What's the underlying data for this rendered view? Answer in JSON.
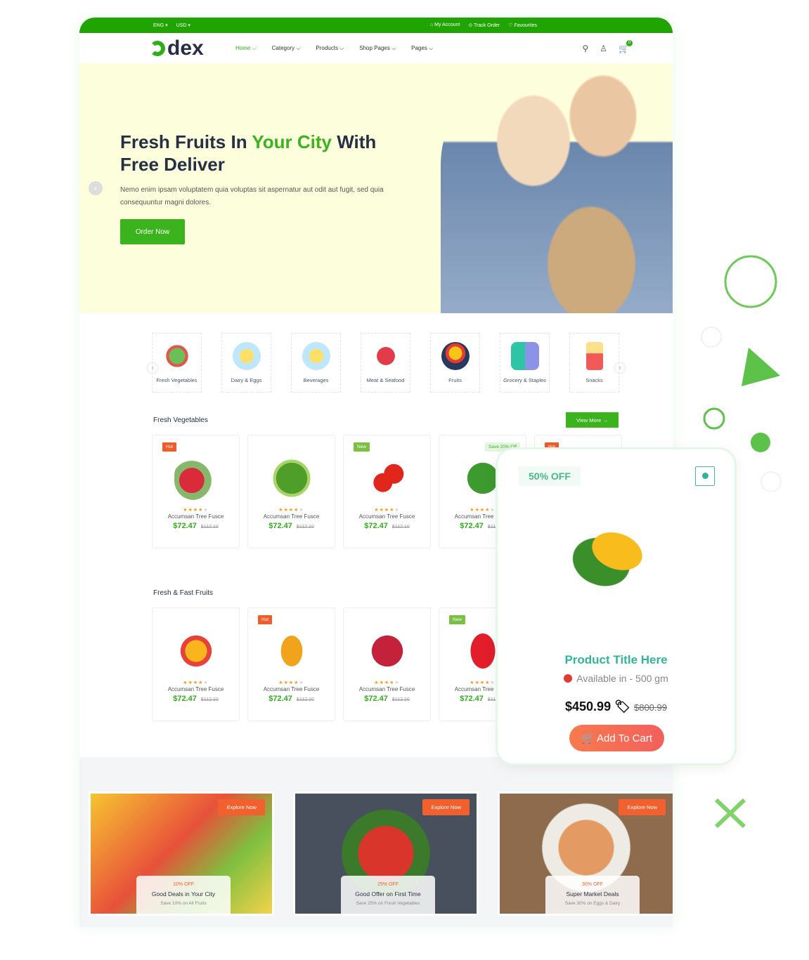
{
  "topbar": {
    "language": "ENG ▾",
    "currency": "USD ▾",
    "my_account": "My Account",
    "track_order": "Track Order",
    "favourites": "Favourites"
  },
  "header": {
    "logo": "dex",
    "nav": [
      "Home ⌵",
      "Category ⌵",
      "Products ⌵",
      "Shop Pages ⌵",
      "Pages ⌵"
    ],
    "cart_count": "0"
  },
  "hero": {
    "title_part1": "Fresh Fruits In ",
    "title_highlight": "Your City",
    "title_part2": " With Free Deliver",
    "text": "Nemo enim ipsam voluptatem quia voluptas sit aspernatur aut odit aut fugit, sed quia consequuntur magni dolores.",
    "button": "Order Now"
  },
  "categories": [
    "Fresh Vegetables",
    "Dairy & Eggs",
    "Beverages",
    "Meat & Seafood",
    "Fruits",
    "Grocery & Staples",
    "Snacks"
  ],
  "sections": {
    "vegetables_title": "Fresh Vegetables",
    "view_more": "View More →",
    "fruits_title": "Fresh & Fast Fruits"
  },
  "vegetables": [
    {
      "tag": "Hot",
      "name": "Accumsan Tree Fusce",
      "price": "$72.47",
      "old_price": "$112.10",
      "rating": 4
    },
    {
      "tag": "",
      "name": "Accumsan Tree Fusce",
      "price": "$72.47",
      "old_price": "$112.10",
      "rating": 4
    },
    {
      "tag": "New",
      "name": "Accumsan Tree Fusce",
      "price": "$72.47",
      "old_price": "$112.10",
      "rating": 4
    },
    {
      "tag": "Save 20% Off",
      "name": "Accumsan Tree Fusce",
      "price": "$72.47",
      "old_price": "$112.10",
      "rating": 4
    },
    {
      "tag": "Hot",
      "name": "",
      "price": "",
      "old_price": "",
      "rating": 0
    }
  ],
  "fruits": [
    {
      "tag": "",
      "name": "Accumsan Tree Fusce",
      "price": "$72.47",
      "old_price": "$112.10",
      "rating": 4
    },
    {
      "tag": "Hot",
      "name": "Accumsan Tree Fusce",
      "price": "$72.47",
      "old_price": "$112.10",
      "rating": 4
    },
    {
      "tag": "",
      "name": "Accumsan Tree Fusce",
      "price": "$72.47",
      "old_price": "$112.10",
      "rating": 4
    },
    {
      "tag": "New",
      "name": "Accumsan Tree Fusce",
      "price": "$72.47",
      "old_price": "$112.10",
      "rating": 4
    }
  ],
  "banners": [
    {
      "button": "Explore Now",
      "off": "10% OFF",
      "title": "Good Deals in Your City",
      "sub": "Save 10% on All Fruits"
    },
    {
      "button": "Explore Now",
      "off": "25% OFF",
      "title": "Good Offer on First Time",
      "sub": "Save 25% on Fresh Vegetables"
    },
    {
      "button": "Explore Now",
      "off": "30% OFF",
      "title": "Super Market Deals",
      "sub": "Save 30% on Eggs & Dairy"
    }
  ],
  "popup": {
    "discount": "50% OFF",
    "title": "Product Title Here",
    "availability": "Available in - 500 gm",
    "price": "$450.99",
    "old_price": "$800.99",
    "button": "Add To Cart"
  },
  "colors": {
    "brand": "#1fa402",
    "accent_orange": "#f2602d",
    "teal": "#2fb59b",
    "hero_bg": "#fdfedb"
  }
}
